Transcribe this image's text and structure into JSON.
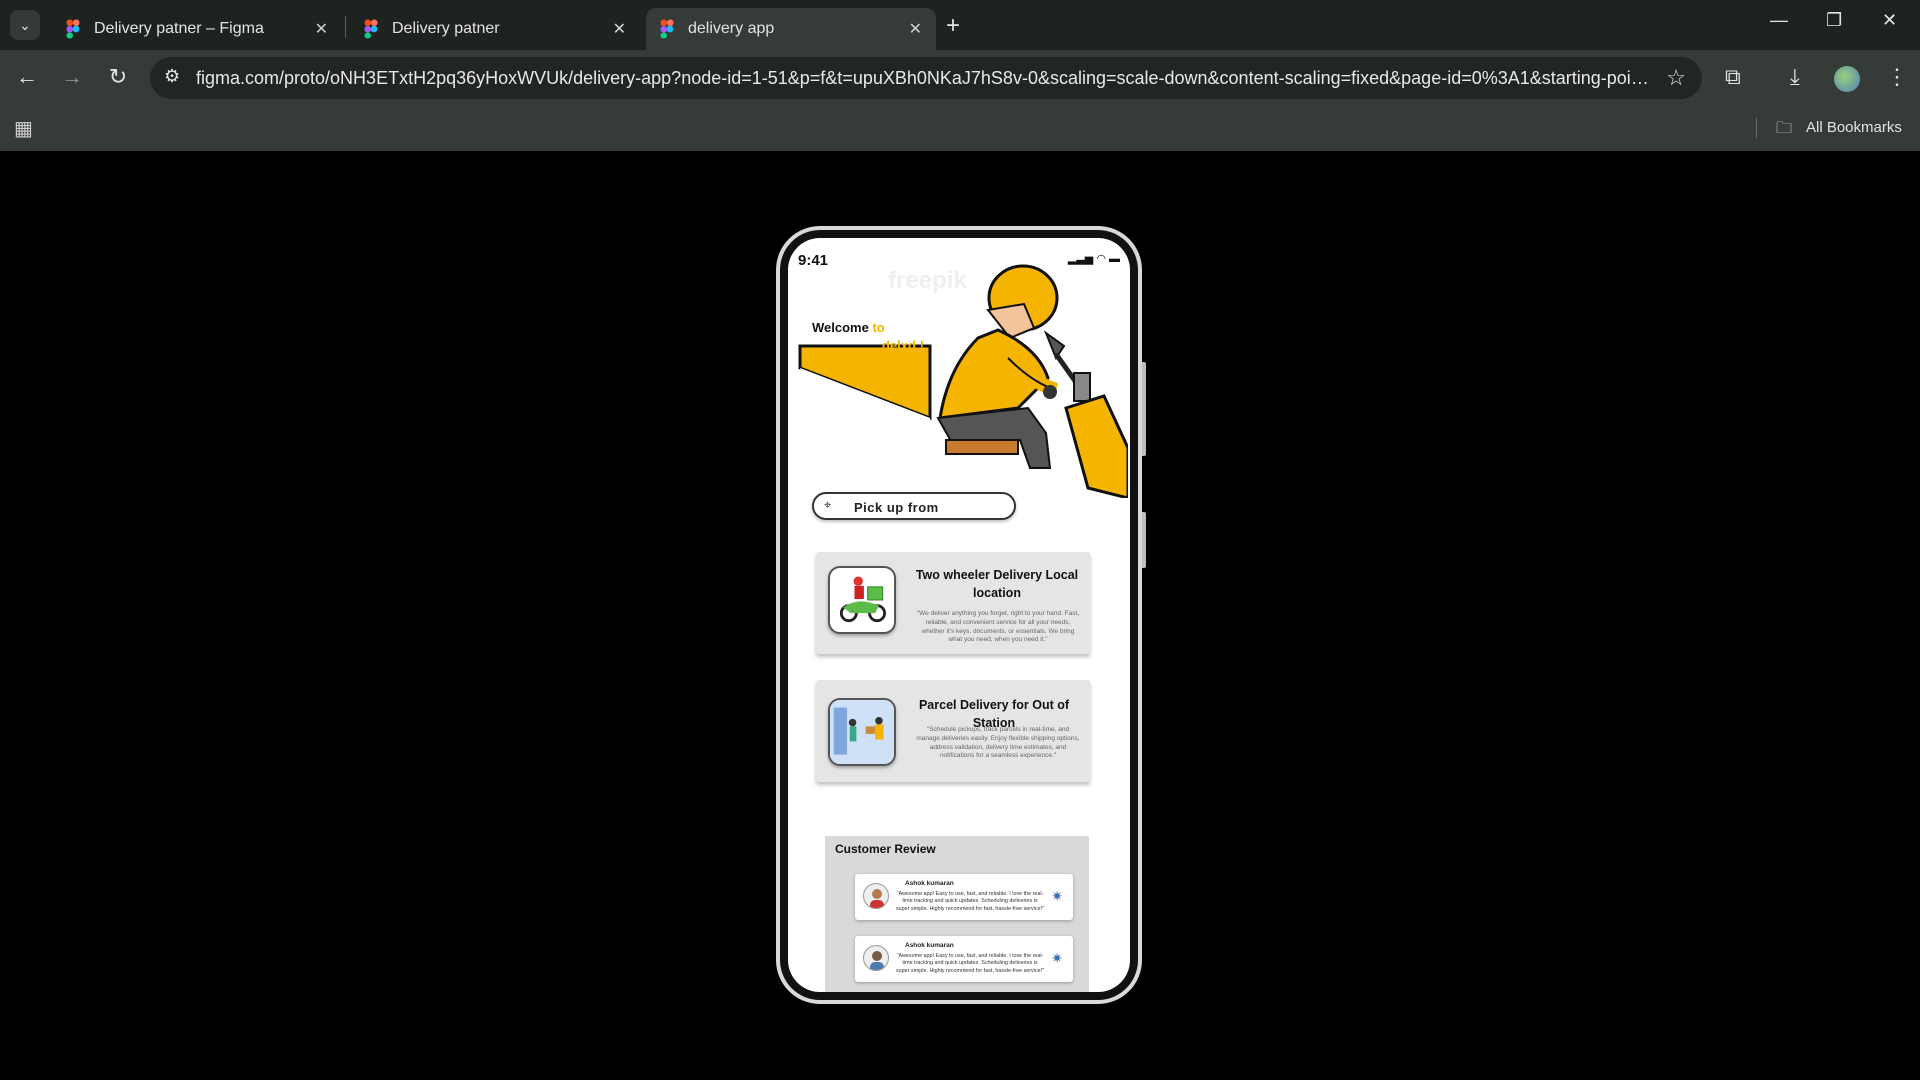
{
  "browser": {
    "tabs": [
      {
        "title": "Delivery patner – Figma",
        "active": false
      },
      {
        "title": "Delivery patner",
        "active": false
      },
      {
        "title": "delivery app",
        "active": true
      }
    ],
    "new_tab": "+",
    "url": "figma.com/proto/oNH3ETxtH2pq36yHoxWVUk/delivery-app?node-id=1-51&p=f&t=upuXBh0NKaJ7hS8v-0&scaling=scale-down&content-scaling=fixed&page-id=0%3A1&starting-point...",
    "bookmarks_label": "All Bookmarks",
    "icons": {
      "back": "back-arrow-icon",
      "forward": "forward-arrow-icon",
      "reload": "reload-icon",
      "site_info": "tune-icon",
      "bookmark": "star-icon",
      "extensions": "puzzle-icon",
      "download": "download-icon",
      "menu": "kebab-menu-icon"
    }
  },
  "app": {
    "status_time": "9:41",
    "welcome_prefix": "Welcome",
    "welcome_to": "to",
    "brand": "delxd !",
    "watermark": "freepik",
    "pickup_label": "Pick up from",
    "cards": [
      {
        "title": "Two wheeler Delivery Local location",
        "description": "\"We deliver anything you forget, right to your hand. Fast, reliable, and convenient service for all your needs, whether it's keys, documents, or essentials. We bring what you need, when you need it.\""
      },
      {
        "title": "Parcel Delivery for Out of Station",
        "description": "\"Schedule pickups, track parcels in real-time, and manage deliveries easily. Enjoy flexible shipping options, address validation, delivery time estimates, and notifications for a seamless experience.\""
      }
    ],
    "review_title": "Customer Review",
    "reviews": [
      {
        "name": "Ashok kumaran",
        "text": "\"Awesome app! Easy to use, fast, and reliable. I love the real-time tracking and quick updates. Scheduling deliveries is super simple. Highly recommend for fast, hassle-free service!\""
      },
      {
        "name": "Ashok kumaran",
        "text": "\"Awesome app! Easy to use, fast, and reliable. I love the real-time tracking and quick updates. Scheduling deliveries is super simple. Highly recommend for fast, hassle-free service!\""
      }
    ],
    "colors": {
      "accent": "#f5b400",
      "card_bg": "#e5e5e5",
      "review_bg": "#d9d9d9"
    }
  }
}
